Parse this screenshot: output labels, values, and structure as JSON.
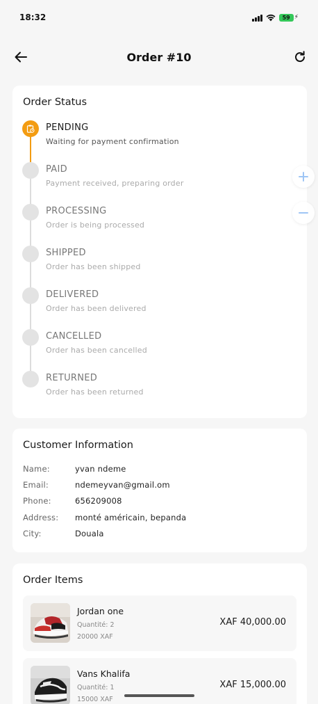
{
  "status_bar": {
    "time": "18:32",
    "battery": "59",
    "icons": [
      "signal-icon",
      "wifi-icon",
      "battery-icon",
      "charging-icon"
    ]
  },
  "app_bar": {
    "title": "Order #10",
    "back_icon": "arrow-left-icon",
    "refresh_icon": "refresh-icon"
  },
  "order_status": {
    "title": "Order Status",
    "accent_color": "#f39c12",
    "steps": [
      {
        "label": "PENDING",
        "description": "Waiting for payment confirmation",
        "active": true
      },
      {
        "label": "PAID",
        "description": "Payment received, preparing order",
        "active": false
      },
      {
        "label": "PROCESSING",
        "description": "Order is being processed",
        "active": false
      },
      {
        "label": "SHIPPED",
        "description": "Order has been shipped",
        "active": false
      },
      {
        "label": "DELIVERED",
        "description": "Order has been delivered",
        "active": false
      },
      {
        "label": "CANCELLED",
        "description": "Order has been cancelled",
        "active": false
      },
      {
        "label": "RETURNED",
        "description": "Order has been returned",
        "active": false
      }
    ]
  },
  "zoom": {
    "in_icon": "plus-icon",
    "out_icon": "minus-icon",
    "color": "#9ec5f5"
  },
  "customer": {
    "title": "Customer Information",
    "rows": [
      {
        "label": "Name:",
        "value": "yvan ndeme"
      },
      {
        "label": "Email:",
        "value": "ndemeyvan@gmail.om"
      },
      {
        "label": "Phone:",
        "value": "656209008"
      },
      {
        "label": "Address:",
        "value": "monté américain, bepanda"
      },
      {
        "label": "City:",
        "value": "Douala"
      }
    ]
  },
  "order_items": {
    "title": "Order Items",
    "items": [
      {
        "name": "Jordan one",
        "quantity": "Quantité: 2",
        "unit_price": "20000 XAF",
        "total": "XAF 40,000.00"
      },
      {
        "name": "Vans Khalifa",
        "quantity": "Quantité: 1",
        "unit_price": "15000 XAF",
        "total": "XAF 15,000.00"
      }
    ]
  }
}
